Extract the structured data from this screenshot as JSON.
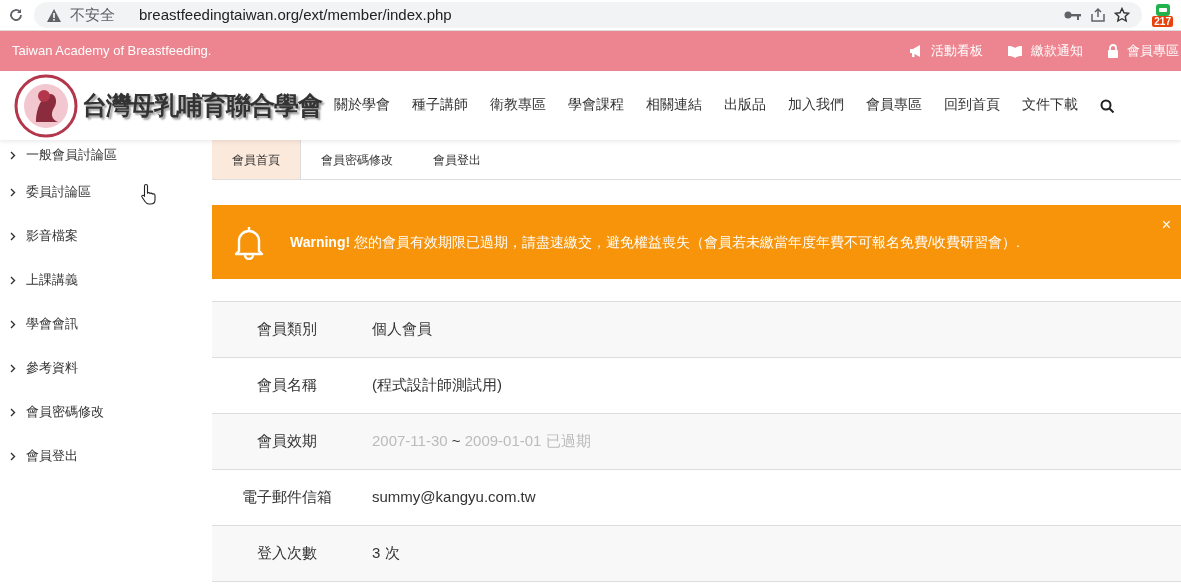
{
  "browser": {
    "security_label": "不安全",
    "url": "breastfeedingtaiwan.org/ext/member/index.php",
    "extension_badge": "217"
  },
  "topbar": {
    "tagline": "Taiwan Academy of Breastfeeding.",
    "links": [
      {
        "label": "活動看板"
      },
      {
        "label": "繳款通知"
      },
      {
        "label": "會員專區"
      }
    ]
  },
  "header": {
    "logo_text": "台灣母乳哺育聯合學會",
    "nav": [
      "關於學會",
      "種子講師",
      "衛教專區",
      "學會課程",
      "相關連結",
      "出版品",
      "加入我們",
      "會員專區",
      "回到首頁",
      "文件下載"
    ]
  },
  "sidebar": {
    "items": [
      "一般會員討論區",
      "委員討論區",
      "影音檔案",
      "上課講義",
      "學會會訊",
      "參考資料",
      "會員密碼修改",
      "會員登出"
    ]
  },
  "tabs": [
    {
      "label": "會員首頁",
      "selected": true
    },
    {
      "label": "會員密碼修改",
      "selected": false
    },
    {
      "label": "會員登出",
      "selected": false
    }
  ],
  "alert": {
    "close": "×",
    "title": "Warning!",
    "message": "您的會員有效期限已過期，請盡速繳交，避免權益喪失（會員若未繳當年度年費不可報名免費/收費研習會）."
  },
  "member_table": [
    {
      "kind": "text",
      "label": "會員類別",
      "value": "個人會員"
    },
    {
      "kind": "text",
      "label": "會員名稱",
      "value": "(程式設計師測試用)"
    },
    {
      "kind": "period",
      "label": "會員效期",
      "start": "2007-11-30",
      "separator": "~",
      "end": "2009-01-01 已過期"
    },
    {
      "kind": "text",
      "label": "電子郵件信箱",
      "value": "summy@kangyu.com.tw"
    },
    {
      "kind": "text",
      "label": "登入次數",
      "value": "3 次"
    }
  ]
}
